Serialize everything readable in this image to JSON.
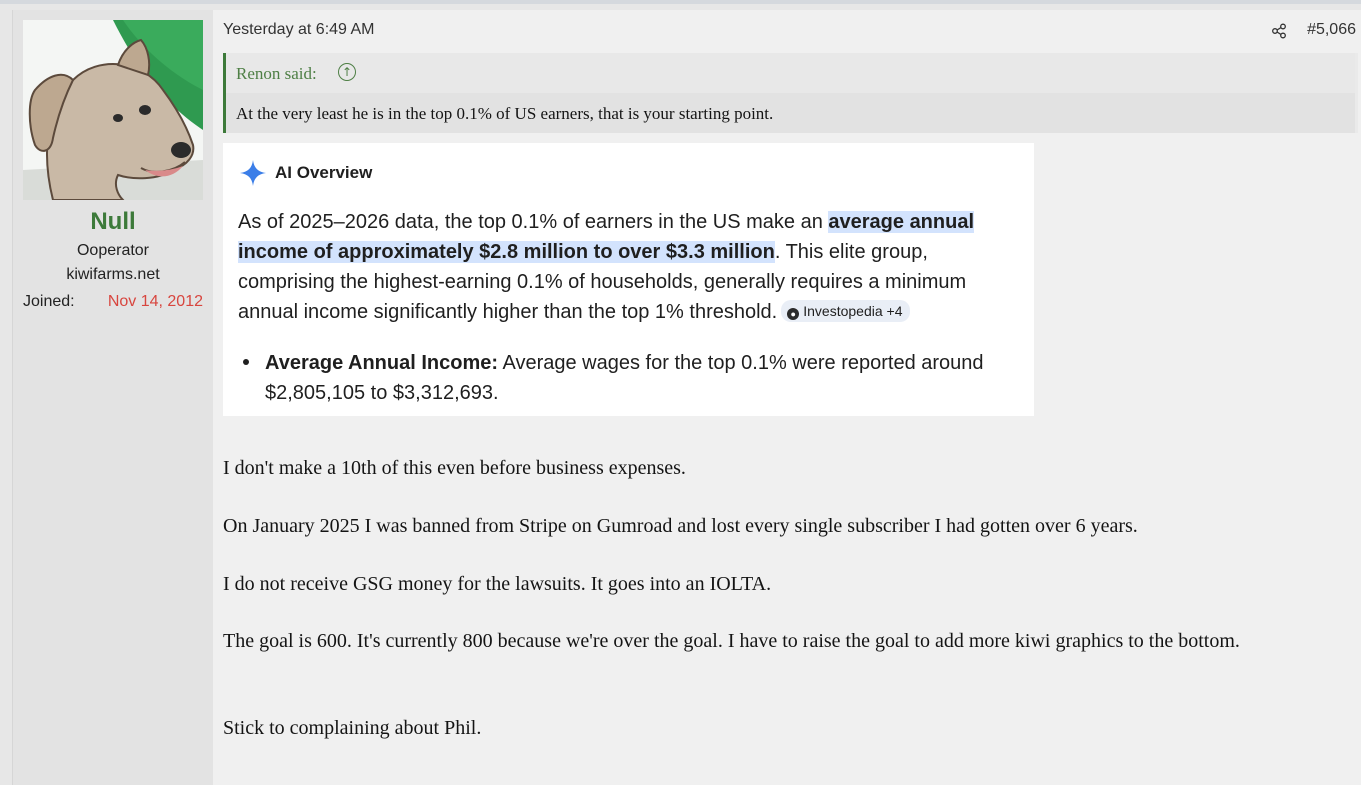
{
  "post": {
    "date": "Yesterday at 6:49 AM",
    "number": "#5,066"
  },
  "user": {
    "name": "Null",
    "title": "Ooperator",
    "banner": "kiwifarms.net",
    "joined_label": "Joined:",
    "joined_date": "Nov 14, 2012"
  },
  "quote": {
    "author": "Renon said:",
    "text": "At the very least he is in the top 0.1% of US earners, that is your starting point."
  },
  "ai_overview": {
    "title": "AI Overview",
    "para_start": "As of 2025–2026 data, the top 0.1% of earners in the US make an ",
    "para_highlight": "average annual income of approximately $2.8 million to over $3.3 million",
    "para_end": ". This elite group, comprising the highest-earning 0.1% of households, generally requires a minimum annual income significantly higher than the top 1% threshold.",
    "source": "Investopedia +4",
    "bullet_label": "Average Annual Income:",
    "bullet_text": " Average wages for the top 0.1% were reported around $2,805,105 to $3,312,693."
  },
  "body": {
    "p1": "I don't make a 10th of this even before business expenses.",
    "p2": "On January 2025 I was banned from Stripe on Gumroad and lost every single subscriber I had gotten over 6 years.",
    "p3": "I do not receive GSG money for the lawsuits. It goes into an IOLTA.",
    "p4": "The goal is 600. It's currently 800 because we're over the goal. I have to raise the goal to add more kiwi graphics to the bottom.",
    "p5": "Stick to complaining about Phil."
  },
  "icons": {
    "share": "share-icon",
    "quote_up": "arrow-up-circle-icon",
    "ai": "sparkle-icon"
  }
}
